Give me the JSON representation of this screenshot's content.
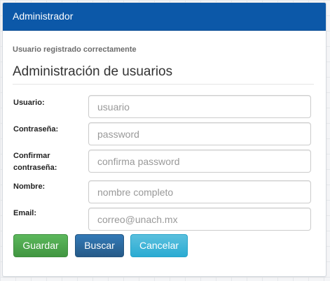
{
  "panel": {
    "title": "Administrador"
  },
  "status_message": "Usuario registrado correctamente",
  "section_title": "Administración de usuarios",
  "form": {
    "fields": [
      {
        "label": "Usuario:",
        "value": "",
        "placeholder": "usuario"
      },
      {
        "label": "Contraseña:",
        "value": "",
        "placeholder": "password"
      },
      {
        "label_line1": "Confirmar",
        "label_line2": "contraseña:",
        "value": "",
        "placeholder": "confirma password"
      },
      {
        "label": "Nombre:",
        "value": "",
        "placeholder": "nombre completo"
      },
      {
        "label": "Email:",
        "value": "",
        "placeholder": "correo@unach.mx"
      }
    ]
  },
  "buttons": {
    "save": "Guardar",
    "search": "Buscar",
    "cancel": "Cancelar"
  },
  "colors": {
    "header": "#0c58a8",
    "save": "#4cae4c",
    "search": "#2e6da4",
    "cancel": "#46b8da"
  }
}
